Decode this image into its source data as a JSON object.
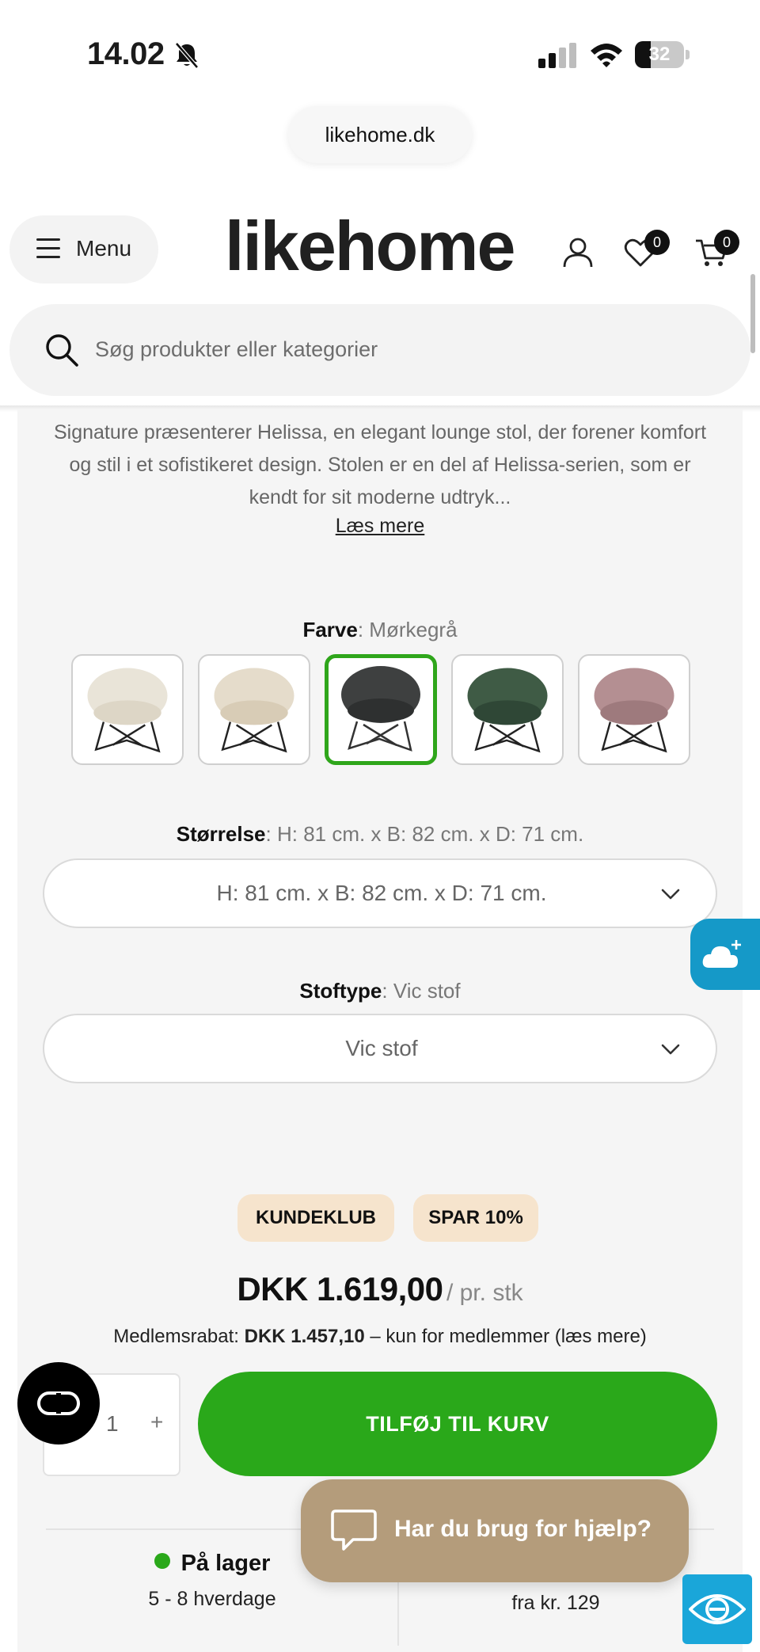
{
  "status_bar": {
    "time": "14.02",
    "battery_level": "32"
  },
  "browser": {
    "url": "likehome.dk"
  },
  "header": {
    "menu_label": "Menu",
    "logo": "likehome",
    "wishlist_count": "0",
    "cart_count": "0"
  },
  "search": {
    "placeholder": "Søg produkter eller kategorier"
  },
  "product": {
    "description": "Signature præsenterer Helissa, en elegant lounge stol, der forener komfort og stil i et sofistikeret design. Stolen er en del af Helissa-serien, som er kendt for sit moderne udtryk...",
    "read_more": "Læs mere",
    "color": {
      "label": "Farve",
      "value": "Mørkegrå",
      "swatches": [
        {
          "name": "cream-boucle",
          "color": "#e9e4d8"
        },
        {
          "name": "beige-boucle",
          "color": "#e5dccb"
        },
        {
          "name": "dark-grey",
          "color": "#3e4040",
          "selected": true
        },
        {
          "name": "green",
          "color": "#3f5b45"
        },
        {
          "name": "rose",
          "color": "#b48f92"
        }
      ]
    },
    "size": {
      "label": "Størrelse",
      "value": "H: 81 cm. x B: 82 cm. x D: 71 cm.",
      "selected": "H: 81 cm. x B: 82 cm. x D: 71 cm."
    },
    "fabric": {
      "label": "Stoftype",
      "value": "Vic stof",
      "selected": "Vic stof"
    },
    "tags": {
      "club": "KUNDEKLUB",
      "save": "SPAR 10%"
    },
    "price": "DKK 1.619,00",
    "price_unit": "/ pr. stk",
    "member": {
      "prefix": "Medlemsrabat:",
      "price": "DKK 1.457,10",
      "suffix": "– kun for medlemmer (læs mere)"
    },
    "quantity": "1",
    "quantity_plus": "+",
    "add_to_cart": "TILFØJ TIL KURV",
    "stock_title": "På lager",
    "stock_delivery": "5 - 8 hverdage",
    "shipping": "fra kr. 129"
  },
  "help": {
    "label": "Har du brug for hjælp?"
  },
  "colors": {
    "green": "#2aa81a",
    "tag_bg": "#f6e4cd",
    "help_bg": "#b49c7b",
    "cloud_bg": "#1599c8"
  }
}
